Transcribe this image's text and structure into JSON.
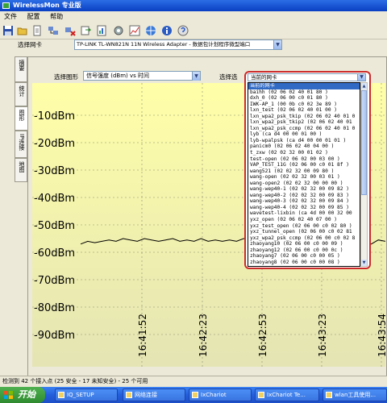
{
  "window": {
    "title": "WirelessMon 专业版"
  },
  "menu": [
    "文件",
    "配置",
    "帮助"
  ],
  "toolbar": {
    "icons": [
      "save-icon",
      "open-icon",
      "new-icon",
      "network-icon",
      "disconnect-icon",
      "export-icon",
      "report-icon",
      "settings-icon",
      "chart-icon",
      "gps-icon",
      "info-icon",
      "help-icon"
    ]
  },
  "adapter": {
    "label": "选择网卡",
    "value": "TP-LINK TL-WN821N 11N Wireless Adapter - 数据包计划程序微型端口"
  },
  "side_tabs": [
    "摘要",
    "统计",
    "图形",
    "IP连接",
    "地图"
  ],
  "active_tab": 2,
  "graph_select": {
    "label": "选择图形",
    "value": "信号强度 (dBm) vs 时间"
  },
  "select2": {
    "label": "选择选",
    "value": "当前的网卡"
  },
  "dropdown": {
    "selected_index": 0,
    "items": [
      "当前的网卡",
      "baihh  (02 06 02 40 01 80 )",
      "dxh_0  (02 06 00 c0 01 80 )",
      "IWK-AP_1  (00 0b c0 02 3e 89 )",
      "lxn_test  (02 06 02 40 01 00 )",
      "lxn_wpa2_psk_tkip  (02 06 02 40 01 0",
      "lxn_wpa2_psk_tkip2  (02 06 02 40 01",
      "lxn_wpa2_psk_ccmp  (02 06 02 40 01 0",
      "lyb  (ca d4 00 00 01 00 )",
      "lyb-wpalpsk  (ca d4 00 00 01 01 )",
      "panicm0  (02 06 02 40 04 00 )",
      "t_zxw  (02 02 32 00 01 02 )",
      "test-open  (02 06 02 00 03 00 )",
      "VAP_TEST_11G  (02 06 00 c0 01 8f )",
      "wang521  (02 02 32 00 09 80 )",
      "wang-open  (02 02 32 00 03 01 )",
      "wang-open2  (02 02 32 00 00 00 )",
      "wang-wep40-1  (02 02 32 00 09 82 )",
      "wang-wep40-2  (02 02 32 00 09 83 )",
      "wang-wep40-3  (02 02 32 00 09 84 )",
      "wang-wep40-4  (02 02 32 00 09 85 )",
      "wavetest-lixbin  (ca 4d 00 00 32 00",
      "yxz_open  (02 06 02 40 07 00 )",
      "yxz_test_open  (02 06 00 c0 02 80 )",
      "yxz_tunnel_open  (02 06 00 c0 02 81",
      "yxz_wpa2_psk_ccmp  (02 06 00 c0 02 8",
      "zhaoyang10  (02 06 00 c0 00 09 )",
      "zhaoyang12  (02 06 00 c0 00 0c )",
      "zhaoyang7  (02 06 00 c0 00 05 )",
      "zhaoyang8  (02 06 00 c0 00 08 )"
    ]
  },
  "chart_data": {
    "type": "line",
    "yticks": [
      "-10dBm",
      "-20dBm",
      "-30dBm",
      "-40dBm",
      "-50dBm",
      "-60dBm",
      "-70dBm",
      "-80dBm",
      "-90dBm"
    ],
    "ylim": [
      -100,
      0
    ],
    "xticks": [
      "16:41:52",
      "16:42:23",
      "16:42:53",
      "16:43:23",
      "16:43:54"
    ],
    "series": [
      {
        "values": [
          -57,
          -56,
          -56.5,
          -56,
          -55.5,
          -56,
          -55,
          -55.5,
          -56,
          -55,
          -55.5,
          -56,
          -55.5,
          -55,
          -56,
          -55.5,
          -56,
          -55,
          -56,
          -55.5,
          -56,
          -55.5,
          -56,
          -55,
          -55.5,
          -56,
          -55.5,
          -56,
          -55,
          -55.5,
          -56,
          -55,
          -56,
          -55.5,
          -56,
          -55,
          -56,
          -55.5,
          -56,
          -55,
          -56.5,
          -57,
          -55.5,
          -56
        ]
      }
    ],
    "grid": true,
    "colors": {
      "background_top": "#ffffa8",
      "background_bottom": "#e4e4b4",
      "line": "#000000",
      "grid": "#8a8a70"
    }
  },
  "status": "检测到 42 个接入点 (25 安全 - 17 未知安全) - 25 个可用",
  "taskbar": {
    "start": "开始",
    "tasks": [
      "IQ_SETUP",
      "网络连接",
      "IxChariot",
      "IxChariot Te...",
      "wlan工具使用..."
    ]
  }
}
